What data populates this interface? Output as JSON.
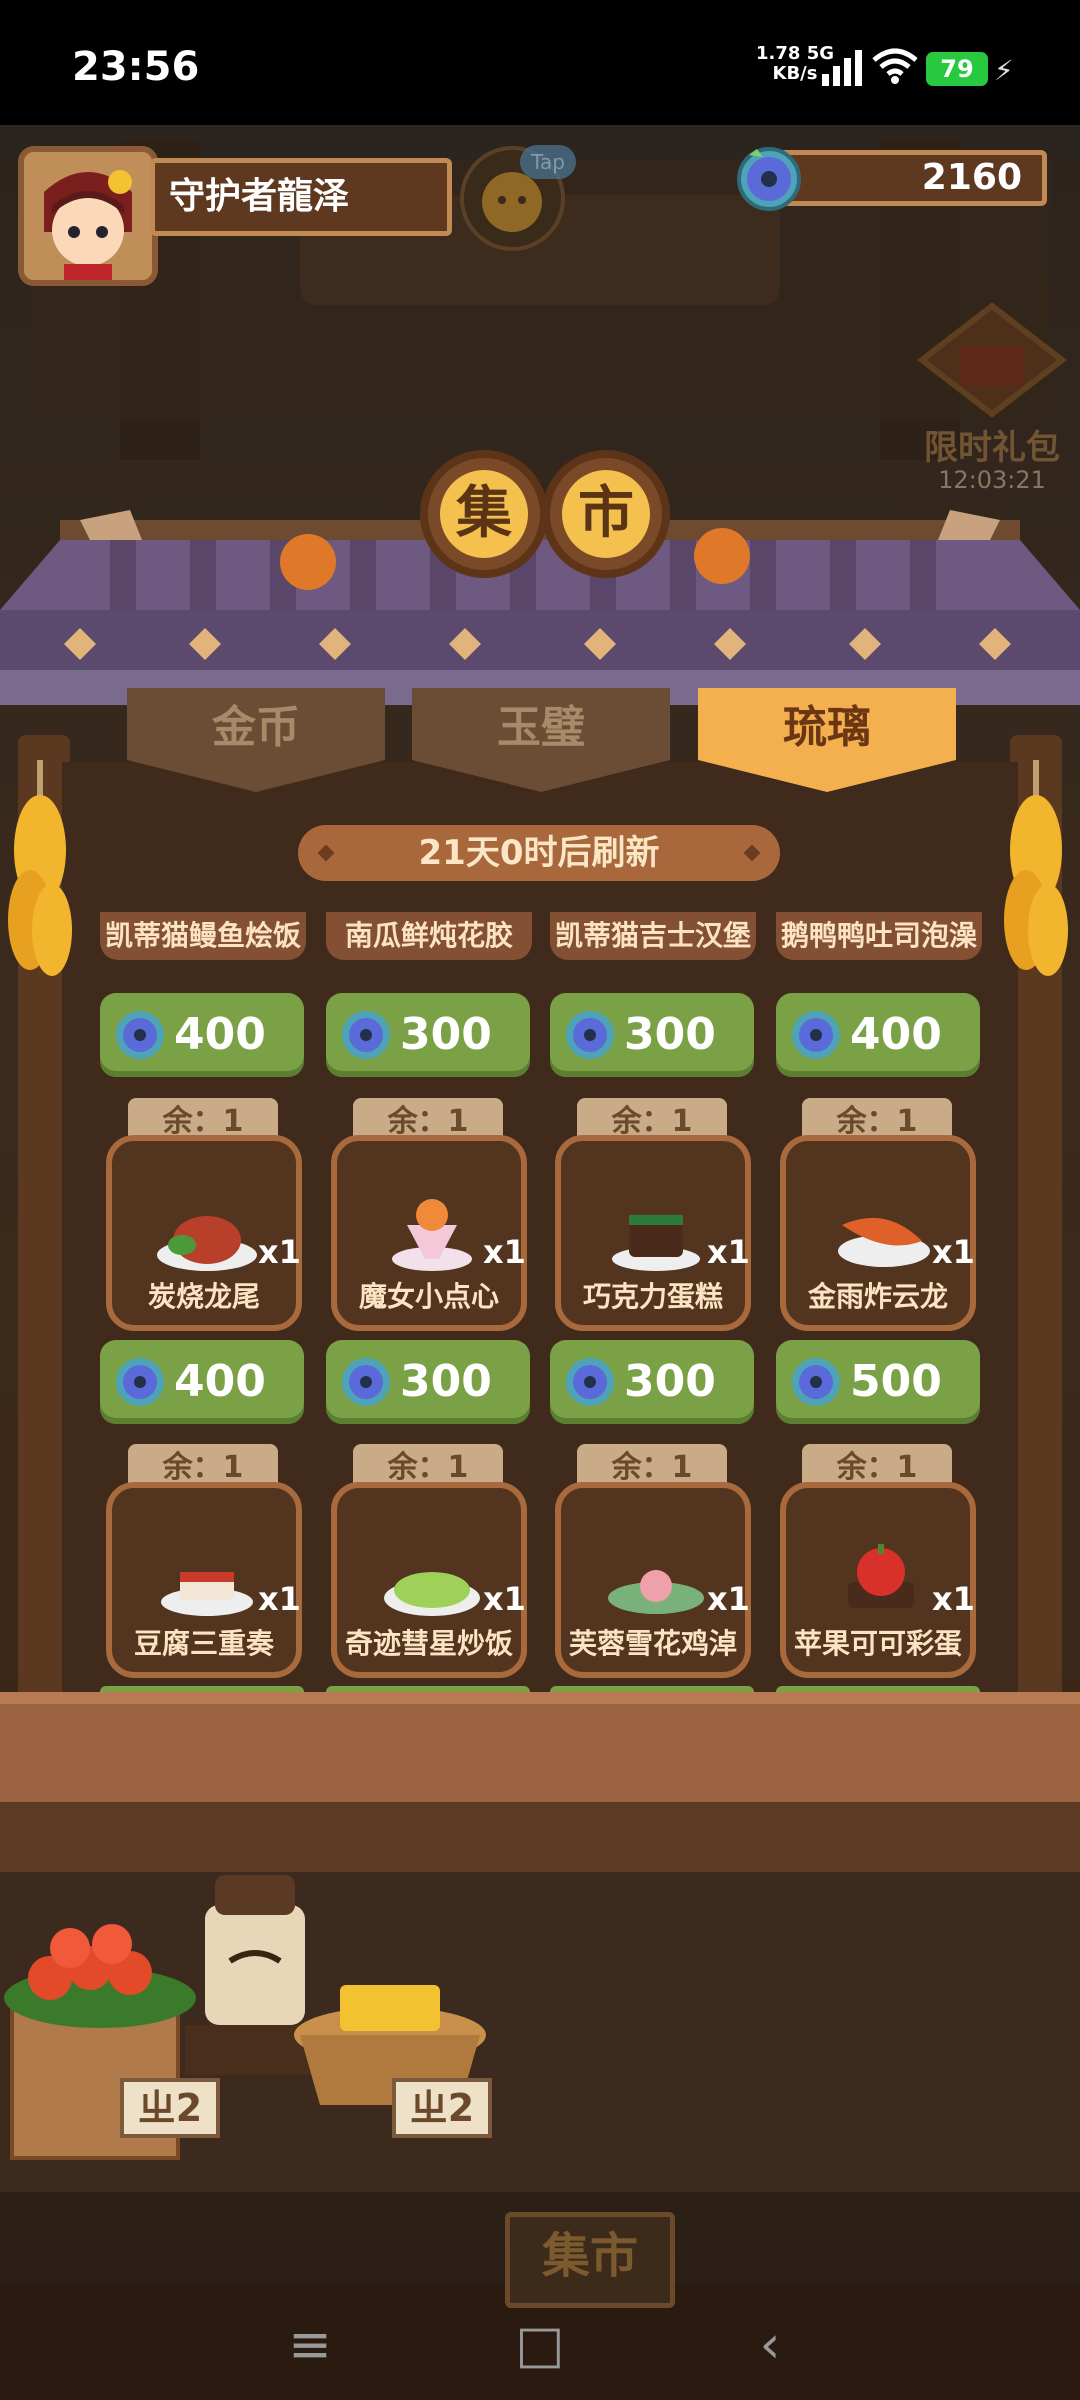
{
  "status": {
    "time": "23:56",
    "net_speed": "1.78",
    "net_unit": "KB/s",
    "net_type": "5G",
    "battery": "79"
  },
  "player": {
    "name": "守护者龍泽",
    "tap_hint": "Tap",
    "currency_amount": "2160"
  },
  "limited_gift": {
    "label": "限时礼包",
    "timer": "12:03:21"
  },
  "market": {
    "title_chars": [
      "集",
      "市"
    ],
    "tabs": [
      {
        "label": "金币",
        "active": false
      },
      {
        "label": "玉璧",
        "active": false
      },
      {
        "label": "琉璃",
        "active": true
      }
    ],
    "refresh_text": "21天0时后刷新",
    "top_row": [
      {
        "name": "凯蒂猫鳗鱼烩饭",
        "price": "400"
      },
      {
        "name": "南瓜鲜炖花胶",
        "price": "300"
      },
      {
        "name": "凯蒂猫吉士汉堡",
        "price": "300"
      },
      {
        "name": "鹅鸭鸭吐司泡澡",
        "price": "400"
      }
    ],
    "row2": [
      {
        "name": "炭烧龙尾",
        "stock": "余：1",
        "qty": "x1",
        "price": "400"
      },
      {
        "name": "魔女小点心",
        "stock": "余：1",
        "qty": "x1",
        "price": "300"
      },
      {
        "name": "巧克力蛋糕",
        "stock": "余：1",
        "qty": "x1",
        "price": "300"
      },
      {
        "name": "金雨炸云龙",
        "stock": "余：1",
        "qty": "x1",
        "price": "500"
      }
    ],
    "row3": [
      {
        "name": "豆腐三重奏",
        "stock": "余：1",
        "qty": "x1"
      },
      {
        "name": "奇迹彗星炒饭",
        "stock": "余：1",
        "qty": "x1"
      },
      {
        "name": "芙蓉雪花鸡淖",
        "stock": "余：1",
        "qty": "x1"
      },
      {
        "name": "苹果可可彩蛋",
        "stock": "余：1",
        "qty": "x1"
      }
    ]
  },
  "stall": {
    "tag_left": "ㄓ2",
    "tag_right": "ㄓ2",
    "bottom_sign": "集市"
  },
  "navbar": {
    "menu": "≡",
    "home": "□",
    "back": "‹"
  },
  "colors": {
    "price_green": "#7aa146",
    "wood": "#5b3820",
    "tab_active": "#f4b04e"
  }
}
